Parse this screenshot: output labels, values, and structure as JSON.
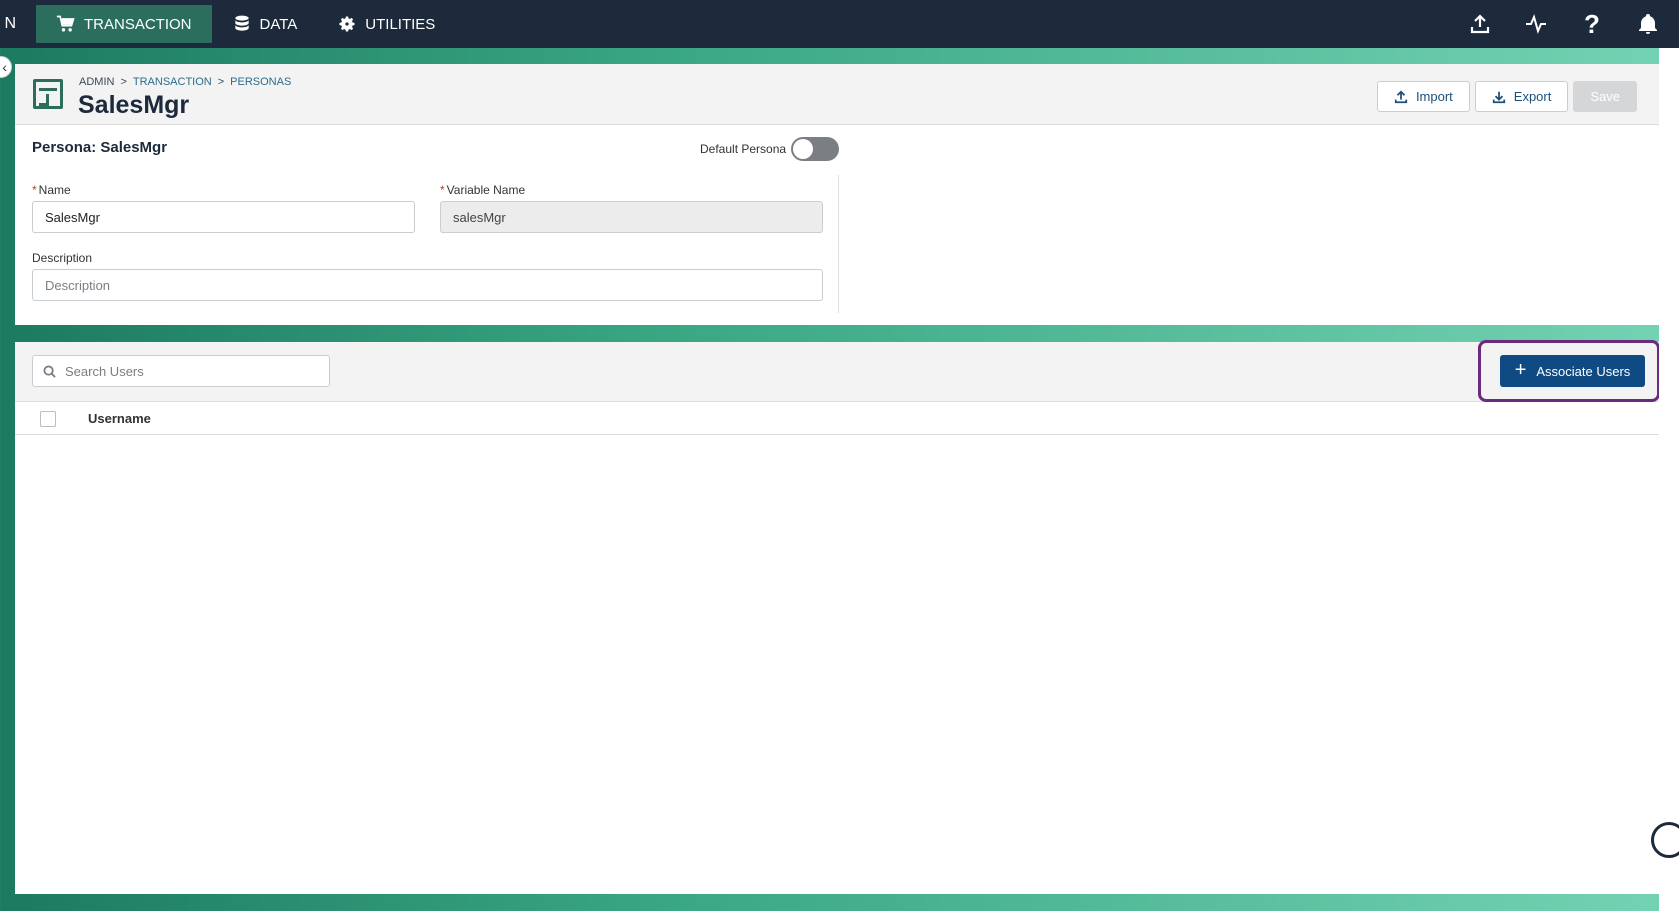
{
  "nav": {
    "cut_label": "N",
    "items": [
      {
        "label": "TRANSACTION",
        "icon": "cart-icon",
        "active": true
      },
      {
        "label": "DATA",
        "icon": "database-icon",
        "active": false
      },
      {
        "label": "UTILITIES",
        "icon": "gear-icon",
        "active": false
      }
    ],
    "right_icons": [
      "upload-icon",
      "activity-icon",
      "help-icon",
      "bell-icon"
    ],
    "help_glyph": "?"
  },
  "header": {
    "breadcrumb": [
      "ADMIN",
      "TRANSACTION",
      "PERSONAS"
    ],
    "title": "SalesMgr",
    "buttons": {
      "import": "Import",
      "export": "Export",
      "save": "Save"
    }
  },
  "form": {
    "persona_title": "Persona: SalesMgr",
    "default_persona_label": "Default Persona",
    "default_persona_on": false,
    "name_label": "Name",
    "name_value": "SalesMgr",
    "variable_label": "Variable Name",
    "variable_value": "salesMgr",
    "description_label": "Description",
    "description_placeholder": "Description"
  },
  "users": {
    "search_placeholder": "Search Users",
    "associate_label": "Associate Users",
    "column_username": "Username",
    "rows": []
  },
  "colors": {
    "nav_bg": "#1c2a3c",
    "nav_active": "#2b6e5e",
    "primary_button": "#0f4a82",
    "highlight": "#6a2a7e"
  }
}
